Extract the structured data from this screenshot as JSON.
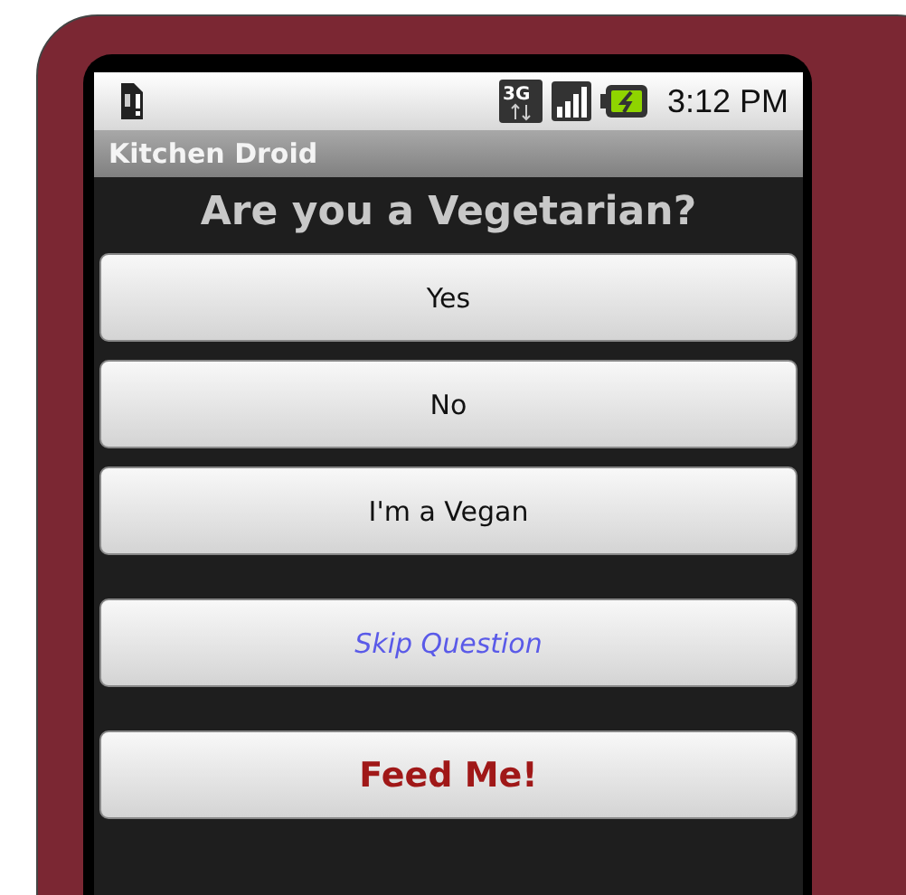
{
  "status_bar": {
    "network_type": "3G",
    "time": "3:12 PM"
  },
  "title_bar": {
    "title": "Kitchen Droid"
  },
  "question": "Are you a Vegetarian?",
  "buttons": [
    {
      "label": "Yes",
      "kind": "answer"
    },
    {
      "label": "No",
      "kind": "answer"
    },
    {
      "label": "I'm a Vegan",
      "kind": "answer"
    },
    {
      "label": "Skip Question",
      "kind": "skip"
    },
    {
      "label": "Feed Me!",
      "kind": "submit"
    }
  ]
}
